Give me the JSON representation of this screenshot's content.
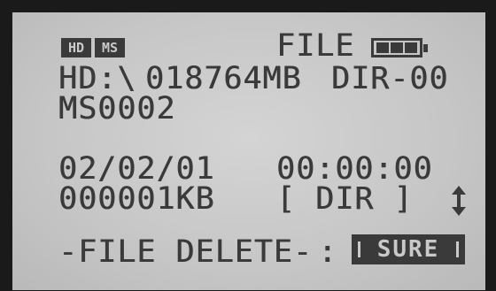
{
  "status": {
    "badges": [
      "HD",
      "MS"
    ],
    "screen_title": "FILE",
    "battery_level": 1.0
  },
  "drive_line": {
    "path": "HD:\\",
    "free_space": "018764MB",
    "dir_index": "DIR-00"
  },
  "folder_name": "MS0002",
  "file_info": {
    "date": "02/02/01",
    "time": "00:00:00",
    "size": "000001KB",
    "type": "[ DIR ]"
  },
  "scroll_icon": "up-down-arrow-icon",
  "action": {
    "label": "-FILE DELETE-",
    "separator": ":",
    "confirm_label": "SURE"
  }
}
